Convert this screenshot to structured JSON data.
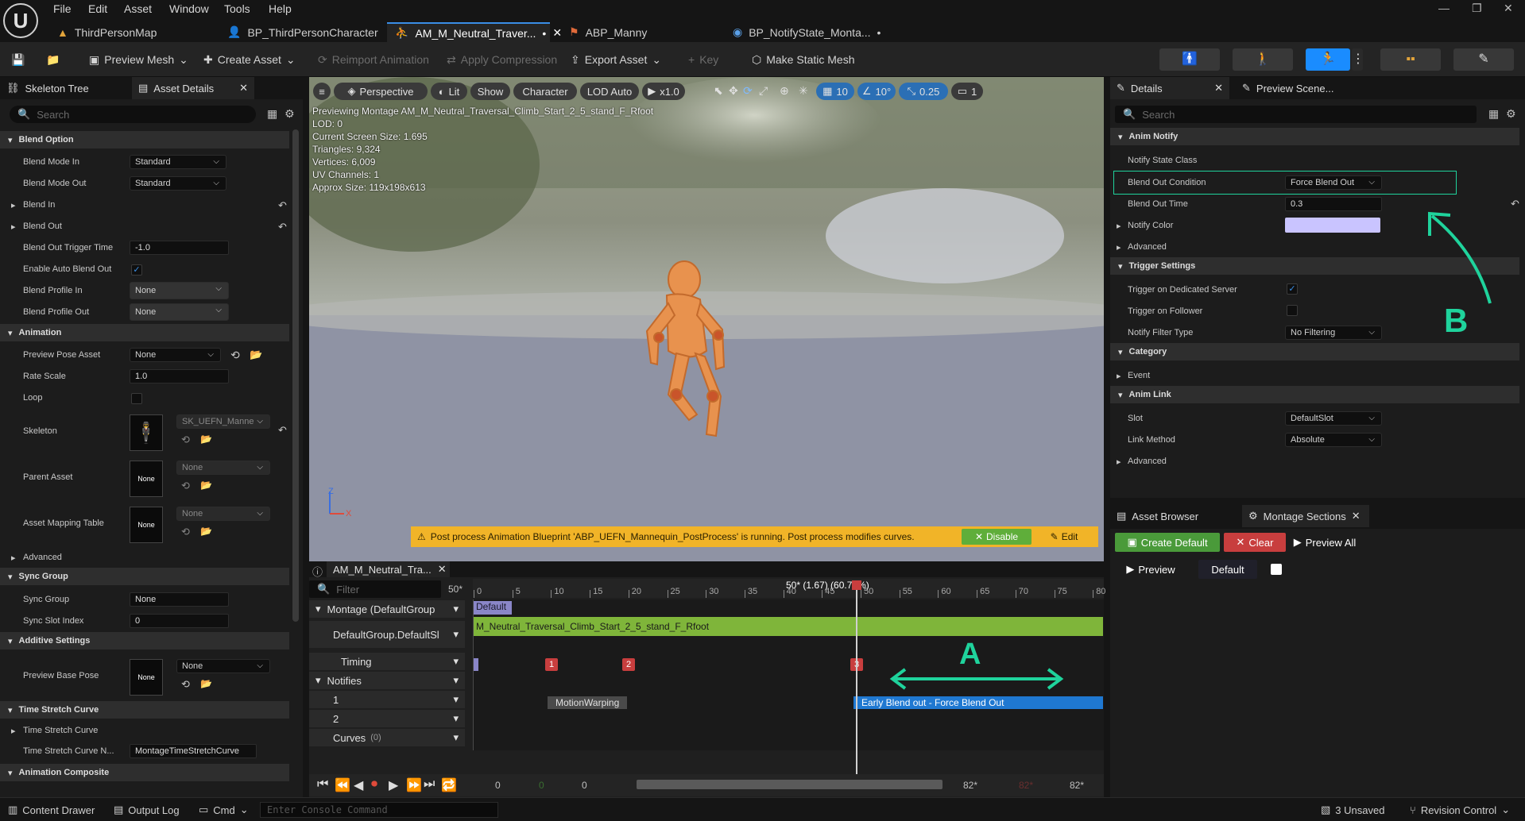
{
  "menu": [
    "File",
    "Edit",
    "Asset",
    "Window",
    "Tools",
    "Help"
  ],
  "tabs": [
    {
      "label": "ThirdPersonMap",
      "icon": "level-icon"
    },
    {
      "label": "BP_ThirdPersonCharacter",
      "icon": "blueprint-icon"
    },
    {
      "label": "AM_M_Neutral_Traver...",
      "icon": "montage-icon",
      "modified": "•",
      "active": true
    },
    {
      "label": "ABP_Manny",
      "icon": "anim-blueprint-icon"
    },
    {
      "label": "BP_NotifyState_Monta...",
      "icon": "blueprint-icon",
      "modified": "•"
    }
  ],
  "toolbar": {
    "preview_mesh": "Preview Mesh",
    "create_asset": "Create Asset",
    "reimport": "Reimport Animation",
    "apply_compression": "Apply Compression",
    "export_asset": "Export Asset",
    "key": "Key",
    "make_static_mesh": "Make Static Mesh"
  },
  "left_panel": {
    "tab_skeleton": "Skeleton Tree",
    "tab_asset_details": "Asset Details",
    "search_placeholder": "Search",
    "sections": {
      "blend_option": "Blend Option",
      "animation": "Animation",
      "sync_group": "Sync Group",
      "additive": "Additive Settings",
      "time_stretch": "Time Stretch Curve",
      "anim_composite": "Animation Composite"
    },
    "props": {
      "blend_mode_in": "Blend Mode In",
      "blend_mode_in_val": "Standard",
      "blend_mode_out": "Blend Mode Out",
      "blend_mode_out_val": "Standard",
      "blend_in": "Blend In",
      "blend_out": "Blend Out",
      "blend_out_trigger": "Blend Out Trigger Time",
      "blend_out_trigger_val": "-1.0",
      "enable_auto": "Enable Auto Blend Out",
      "blend_profile_in": "Blend Profile In",
      "blend_profile_in_val": "None",
      "blend_profile_out": "Blend Profile Out",
      "blend_profile_out_val": "None",
      "preview_pose": "Preview Pose Asset",
      "preview_pose_val": "None",
      "rate_scale": "Rate Scale",
      "rate_scale_val": "1.0",
      "loop": "Loop",
      "skeleton": "Skeleton",
      "skeleton_val": "SK_UEFN_Manne",
      "parent_asset": "Parent Asset",
      "parent_asset_val": "None",
      "parent_thumb": "None",
      "asset_mapping": "Asset Mapping Table",
      "asset_mapping_val": "None",
      "mapping_thumb": "None",
      "advanced": "Advanced",
      "sync_group": "Sync Group",
      "sync_group_val": "None",
      "sync_slot": "Sync Slot Index",
      "sync_slot_val": "0",
      "preview_base": "Preview Base Pose",
      "preview_base_val": "None",
      "base_thumb": "None",
      "ts_curve": "Time Stretch Curve",
      "ts_curve_name": "Time Stretch Curve N...",
      "ts_curve_name_val": "MontageTimeStretchCurve"
    }
  },
  "viewport": {
    "perspective": "Perspective",
    "lit": "Lit",
    "show": "Show",
    "character": "Character",
    "lod": "LOD Auto",
    "speed": "x1.0",
    "grid": "10",
    "angle": "10°",
    "scale": "0.25",
    "cams": "1",
    "stats": [
      "Previewing Montage AM_M_Neutral_Traversal_Climb_Start_2_5_stand_F_Rfoot",
      "LOD: 0",
      "Current Screen Size: 1.695",
      "Triangles: 9,324",
      "Vertices: 6,009",
      "UV Channels: 1",
      "Approx Size: 119x198x613"
    ],
    "axis_z": "Z",
    "axis_x": "X",
    "warning": "Post process Animation Blueprint 'ABP_UEFN_Mannequin_PostProcess' is running. Post process modifies curves.",
    "disable": "Disable",
    "edit": "Edit"
  },
  "timeline": {
    "tab": "AM_M_Neutral_Tra...",
    "filter_placeholder": "Filter",
    "frames": "50*",
    "playhead": "50* (1.67) (60.78%)",
    "ticks": [
      "0",
      "5",
      "10",
      "15",
      "20",
      "25",
      "30",
      "35",
      "40",
      "45",
      "50",
      "55",
      "60",
      "65",
      "70",
      "75",
      "80"
    ],
    "tracks": {
      "montage": "Montage (DefaultGroup",
      "slot": "DefaultGroup.DefaultSl",
      "timing": "Timing",
      "notifies": "Notifies",
      "n1": "1",
      "n2": "2",
      "curves": "Curves",
      "curves_count": "(0)"
    },
    "section_label": "Default",
    "segment": "M_Neutral_Traversal_Climb_Start_2_5_stand_F_Rfoot",
    "timing_marks": [
      "1",
      "2",
      "3"
    ],
    "notify_motion": "MotionWarping",
    "notify_early": "Early Blend out - Force Blend Out",
    "annotation_a": "A",
    "transport": {
      "start": "0",
      "mid": "0",
      "cur": "0",
      "end1": "82*",
      "end2": "82*",
      "end3": "82*"
    }
  },
  "details": {
    "tab_details": "Details",
    "tab_preview": "Preview Scene...",
    "search_placeholder": "Search",
    "sections": {
      "anim_notify": "Anim Notify",
      "trigger": "Trigger Settings",
      "category": "Category",
      "anim_link": "Anim Link"
    },
    "props": {
      "notify_state_class": "Notify State Class",
      "blend_out_condition": "Blend Out Condition",
      "blend_out_condition_val": "Force Blend Out",
      "blend_out_time": "Blend Out Time",
      "blend_out_time_val": "0.3",
      "notify_color": "Notify Color",
      "advanced": "Advanced",
      "trigger_dedicated": "Trigger on Dedicated Server",
      "trigger_follower": "Trigger on Follower",
      "filter_type": "Notify Filter Type",
      "filter_type_val": "No Filtering",
      "event": "Event",
      "slot": "Slot",
      "slot_val": "DefaultSlot",
      "link_method": "Link Method",
      "link_method_val": "Absolute",
      "advanced2": "Advanced"
    },
    "annotation_b": "B"
  },
  "sections_panel": {
    "tab_asset_browser": "Asset Browser",
    "tab_montage_sections": "Montage Sections",
    "create_default": "Create Default",
    "clear": "Clear",
    "preview_all": "Preview All",
    "preview": "Preview",
    "default": "Default"
  },
  "bottombar": {
    "content_drawer": "Content Drawer",
    "output_log": "Output Log",
    "cmd": "Cmd",
    "console_placeholder": "Enter Console Command",
    "unsaved": "3 Unsaved",
    "revision": "Revision Control"
  },
  "colors": {
    "accent": "#1a8cff",
    "segment_green": "#7fb53a",
    "notify_blue": "#1f78d1",
    "warning": "#f1b428",
    "annotation": "#1fd39c",
    "notify_color_swatch": "#c9c4ff"
  }
}
